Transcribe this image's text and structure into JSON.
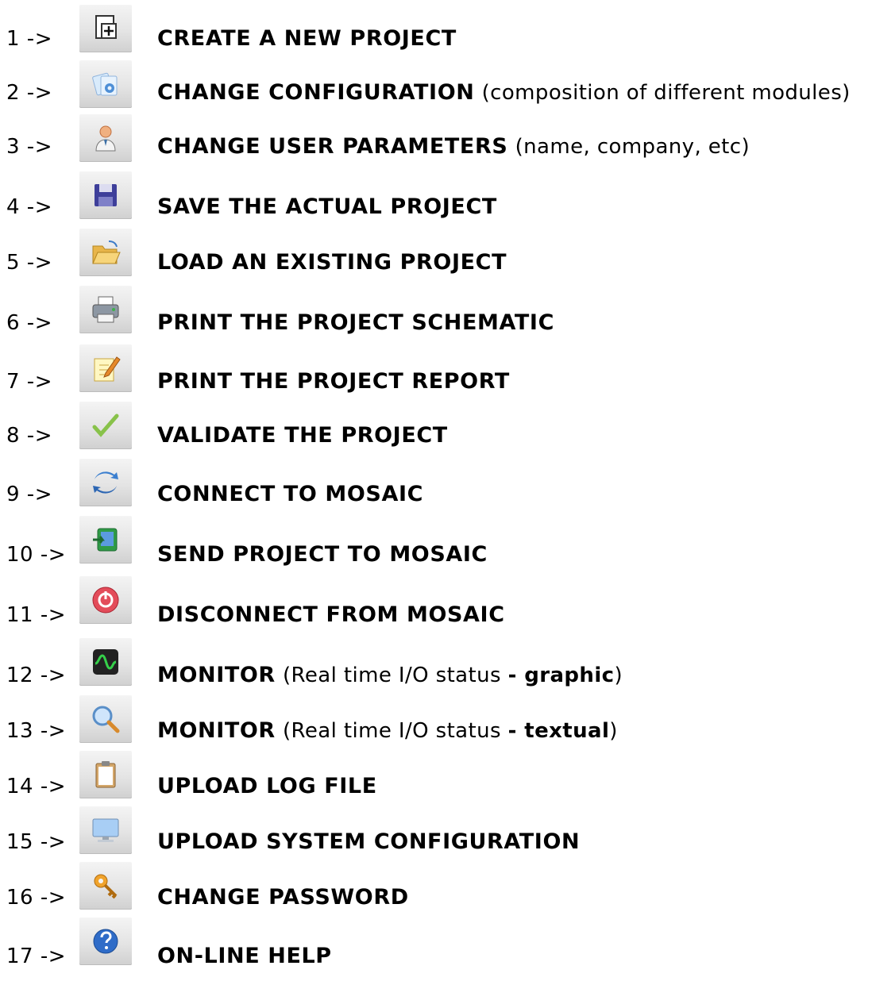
{
  "items": [
    {
      "num": "1 ->",
      "label": "CREATE A NEW PROJECT",
      "icon": "new-project-icon"
    },
    {
      "num": "2 ->",
      "label": "CHANGE CONFIGURATION",
      "note": "(composition of different modules)",
      "icon": "configuration-icon"
    },
    {
      "num": "3 ->",
      "label": "CHANGE USER PARAMETERS",
      "note": "(name, company, etc)",
      "icon": "user-icon"
    },
    {
      "num": "4 ->",
      "label": "SAVE THE ACTUAL PROJECT",
      "icon": "save-icon"
    },
    {
      "num": "5 ->",
      "label": "LOAD AN EXISTING PROJECT",
      "icon": "open-folder-icon"
    },
    {
      "num": "6 ->",
      "label": "PRINT THE PROJECT SCHEMATIC",
      "icon": "printer-icon"
    },
    {
      "num": "7 ->",
      "label": "PRINT THE PROJECT REPORT",
      "icon": "report-pencil-icon"
    },
    {
      "num": "8 ->",
      "label": "VALIDATE THE PROJECT",
      "icon": "checkmark-icon"
    },
    {
      "num": "9 ->",
      "label": "CONNECT TO MOSAIC",
      "icon": "connect-arrows-icon"
    },
    {
      "num": "10 ->",
      "label": "SEND PROJECT TO MOSAIC",
      "icon": "send-project-icon"
    },
    {
      "num": "11 ->",
      "label": "DISCONNECT FROM MOSAIC",
      "icon": "power-off-icon"
    },
    {
      "num": "12 ->",
      "label": "MONITOR",
      "note_pre": "(Real time I/O status ",
      "note_bold": "- graphic",
      "note_post": ")",
      "icon": "oscilloscope-icon"
    },
    {
      "num": "13 ->",
      "label": "MONITOR",
      "note_pre": "(Real time I/O status ",
      "note_bold": "- textual",
      "note_post": ")",
      "icon": "magnifier-icon"
    },
    {
      "num": "14 ->",
      "label": "UPLOAD LOG FILE",
      "icon": "clipboard-icon"
    },
    {
      "num": "15 ->",
      "label": "UPLOAD SYSTEM CONFIGURATION",
      "icon": "monitor-icon"
    },
    {
      "num": "16 ->",
      "label": "CHANGE PASSWORD",
      "icon": "key-arrows-icon"
    },
    {
      "num": "17 ->",
      "label": "ON-LINE HELP",
      "icon": "help-icon"
    }
  ]
}
